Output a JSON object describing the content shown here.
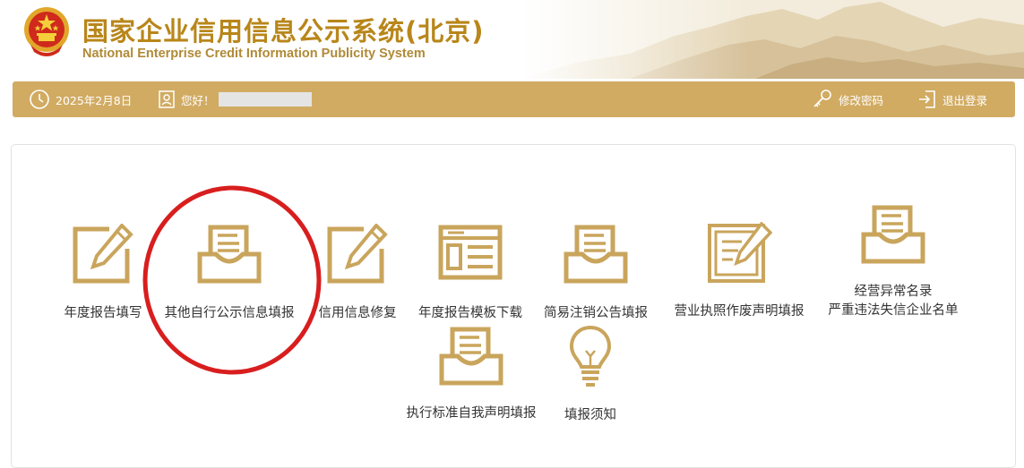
{
  "header": {
    "title_cn": "国家企业信用信息公示系统(北京)",
    "title_en": "National Enterprise Credit Information Publicity System"
  },
  "toolbar": {
    "date": "2025年2月8日",
    "greeting": "您好！",
    "change_password": "修改密码",
    "logout": "退出登录"
  },
  "menu": {
    "items": [
      {
        "label": "年度报告填写",
        "icon": "edit-pencil-icon"
      },
      {
        "label": "其他自行公示信息填报",
        "icon": "inbox-tray-icon"
      },
      {
        "label": "信用信息修复",
        "icon": "edit-pencil-icon"
      },
      {
        "label": "年度报告模板下载",
        "icon": "template-window-icon"
      },
      {
        "label": "简易注销公告填报",
        "icon": "inbox-tray-icon"
      },
      {
        "label": "营业执照作废声明填报",
        "icon": "document-edit-icon"
      },
      {
        "label": "经营异常名录",
        "label2": "严重违法失信企业名单",
        "icon": "inbox-tray-icon"
      },
      {
        "label": "执行标准自我声明填报",
        "icon": "inbox-tray-icon"
      },
      {
        "label": "填报须知",
        "icon": "lightbulb-icon"
      }
    ]
  },
  "colors": {
    "gold": "#d1ab62",
    "icon_gold": "#c9a55c",
    "title_gold": "#b8861a",
    "annotation_red": "#d81e1e"
  }
}
